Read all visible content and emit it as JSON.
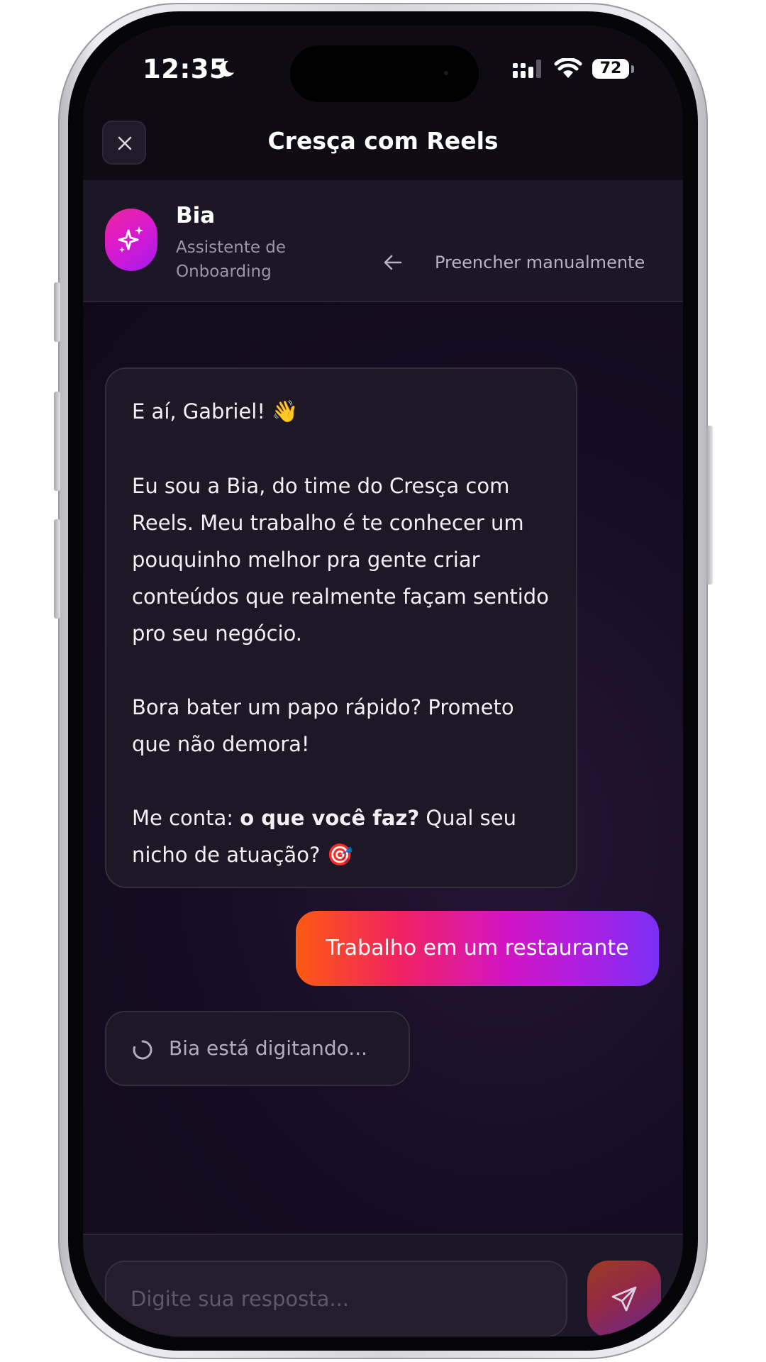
{
  "status_bar": {
    "time": "12:35",
    "battery": "72"
  },
  "header": {
    "title": "Cresça com Reels"
  },
  "agent": {
    "name": "Bia",
    "role": "Assistente de Onboarding",
    "manual_link": "Preencher manualmente"
  },
  "messages": {
    "bot": {
      "greeting": "E aí, Gabriel!",
      "greeting_emoji": "👋",
      "paragraph_1": "Eu sou a Bia, do time do Cresça com Reels. Meu trabalho é te conhecer um pouquinho melhor pra gente criar conteúdos que realmente façam sentido pro seu negócio.",
      "paragraph_2": "Bora bater um papo rápido? Prometo que não demora!",
      "question_prefix": "Me conta:",
      "question_bold": "o que você faz?",
      "question_suffix": "Qual seu nicho de atuação?",
      "question_emoji": "🎯"
    },
    "user": {
      "text": "Trabalho em um restaurante"
    },
    "typing": "Bia está digitando..."
  },
  "composer": {
    "placeholder": "Digite sua resposta...",
    "value": ""
  },
  "colors": {
    "background": "#170d24",
    "bubble": "#1d1826",
    "accent_start": "#fd5a12",
    "accent_mid": "#d314c4",
    "accent_end": "#7b2ff5",
    "avatar": "#d61ad0"
  },
  "icons": {
    "close": "close-icon",
    "avatar": "sparkles-icon",
    "manual": "arrow-left-icon",
    "typing": "spinner-icon",
    "send": "send-icon"
  }
}
